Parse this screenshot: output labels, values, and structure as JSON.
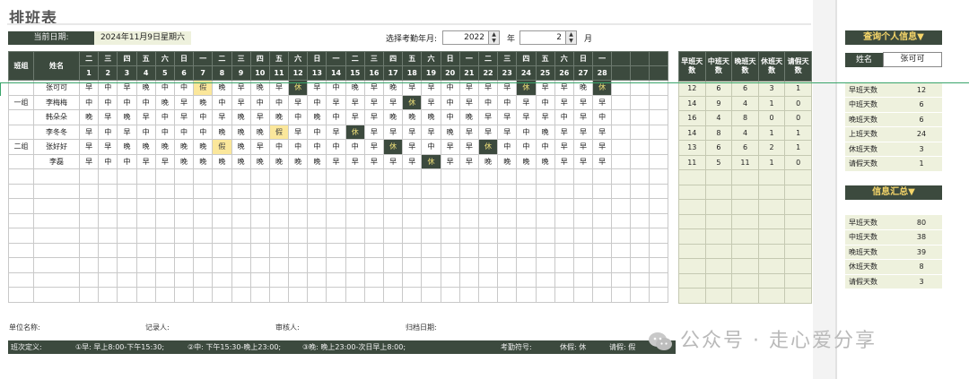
{
  "title": "排班表",
  "current_date_label": "当前日期:",
  "current_date": "2024年11月9日星期六",
  "select_label": "选择考勤年月:",
  "year": "2022",
  "year_unit": "年",
  "month": "2",
  "month_unit": "月",
  "grid": {
    "header_group": "班组",
    "header_name": "姓名",
    "weekdays": [
      "二",
      "三",
      "四",
      "五",
      "六",
      "日",
      "一",
      "二",
      "三",
      "四",
      "五",
      "六",
      "日",
      "一",
      "二",
      "三",
      "四",
      "五",
      "六",
      "日",
      "一",
      "二",
      "三",
      "四",
      "五",
      "六",
      "日",
      "一"
    ],
    "days": [
      "1",
      "2",
      "3",
      "4",
      "5",
      "6",
      "7",
      "8",
      "9",
      "10",
      "11",
      "12",
      "13",
      "14",
      "15",
      "16",
      "17",
      "18",
      "19",
      "20",
      "21",
      "22",
      "23",
      "24",
      "25",
      "26",
      "27",
      "28"
    ],
    "rows": [
      {
        "group": "",
        "name": "张可可",
        "shifts": [
          "早",
          "中",
          "早",
          "晚",
          "中",
          "中",
          "假",
          "晚",
          "早",
          "晚",
          "早",
          "休",
          "早",
          "中",
          "晚",
          "早",
          "晚",
          "早",
          "早",
          "中",
          "早",
          "早",
          "早",
          "休",
          "早",
          "早",
          "晚",
          "休"
        ]
      },
      {
        "group": "一组",
        "name": "李梅梅",
        "shifts": [
          "中",
          "中",
          "中",
          "中",
          "晚",
          "早",
          "晚",
          "中",
          "早",
          "中",
          "中",
          "早",
          "中",
          "早",
          "早",
          "早",
          "早",
          "休",
          "早",
          "中",
          "早",
          "中",
          "中",
          "早",
          "中",
          "早",
          "早",
          "早"
        ]
      },
      {
        "group": "",
        "name": "韩朵朵",
        "shifts": [
          "晚",
          "早",
          "晚",
          "早",
          "中",
          "早",
          "中",
          "早",
          "晚",
          "早",
          "晚",
          "中",
          "晚",
          "中",
          "早",
          "早",
          "晚",
          "晚",
          "晚",
          "中",
          "晚",
          "早",
          "早",
          "早",
          "早",
          "中",
          "早",
          "中"
        ]
      },
      {
        "group": "",
        "name": "李冬冬",
        "shifts": [
          "早",
          "中",
          "早",
          "中",
          "中",
          "中",
          "中",
          "晚",
          "晚",
          "晚",
          "假",
          "早",
          "中",
          "早",
          "休",
          "早",
          "早",
          "早",
          "早",
          "晚",
          "早",
          "早",
          "早",
          "中",
          "晚",
          "早",
          "早",
          "早"
        ]
      },
      {
        "group": "二组",
        "name": "张好好",
        "shifts": [
          "早",
          "早",
          "晚",
          "晚",
          "晚",
          "晚",
          "晚",
          "假",
          "晚",
          "早",
          "中",
          "中",
          "中",
          "中",
          "中",
          "早",
          "休",
          "早",
          "中",
          "早",
          "早",
          "休",
          "中",
          "中",
          "中",
          "早",
          "早",
          "早"
        ]
      },
      {
        "group": "",
        "name": "李磊",
        "shifts": [
          "早",
          "中",
          "中",
          "早",
          "早",
          "晚",
          "晚",
          "晚",
          "晚",
          "晚",
          "晚",
          "晚",
          "晚",
          "早",
          "早",
          "早",
          "早",
          "早",
          "休",
          "早",
          "早",
          "晚",
          "晚",
          "晚",
          "晚",
          "早",
          "早",
          "早"
        ]
      }
    ],
    "empty_rows": 9
  },
  "stats": {
    "headers": [
      "早班天数",
      "中班天数",
      "晚班天数",
      "休班天数",
      "请假天数"
    ],
    "rows": [
      [
        "12",
        "6",
        "6",
        "3",
        "1"
      ],
      [
        "14",
        "9",
        "4",
        "1",
        "0"
      ],
      [
        "16",
        "4",
        "8",
        "0",
        "0"
      ],
      [
        "14",
        "8",
        "4",
        "1",
        "1"
      ],
      [
        "13",
        "6",
        "6",
        "2",
        "1"
      ],
      [
        "11",
        "5",
        "11",
        "1",
        "0"
      ]
    ]
  },
  "sign": {
    "unit": "单位名称:",
    "recorder": "记录人:",
    "reviewer": "审核人:",
    "archive": "归档日期:"
  },
  "footer": {
    "shift_def": "班次定义:",
    "morning": "①早: 早上8:00-下午15:30;",
    "middle": "②中: 下午15:30-晚上23:00;",
    "night": "③晚: 晚上23:00-次日早上8:00;",
    "symbols": "考勤符号:",
    "rest": "休假: 休",
    "leave": "请假: 假"
  },
  "side": {
    "query_title": "查询个人信息▼",
    "name_label": "姓名",
    "name_value": "张可可",
    "personal": [
      {
        "label": "早班天数",
        "value": "12"
      },
      {
        "label": "中班天数",
        "value": "6"
      },
      {
        "label": "晚班天数",
        "value": "6"
      },
      {
        "label": "上班天数",
        "value": "24"
      },
      {
        "label": "休班天数",
        "value": "3"
      },
      {
        "label": "请假天数",
        "value": "1"
      }
    ],
    "summary_title": "信息汇总▼",
    "summary": [
      {
        "label": "早班天数",
        "value": "80"
      },
      {
        "label": "中班天数",
        "value": "38"
      },
      {
        "label": "晚班天数",
        "value": "39"
      },
      {
        "label": "休班天数",
        "value": "8"
      },
      {
        "label": "请假天数",
        "value": "3"
      }
    ]
  },
  "watermark": "公众号 · 走心爱分享",
  "colors": {
    "header": "#3c4a3e",
    "accent": "#f6d66a",
    "leave": "#fbe79b",
    "panel": "#eef1dd"
  }
}
